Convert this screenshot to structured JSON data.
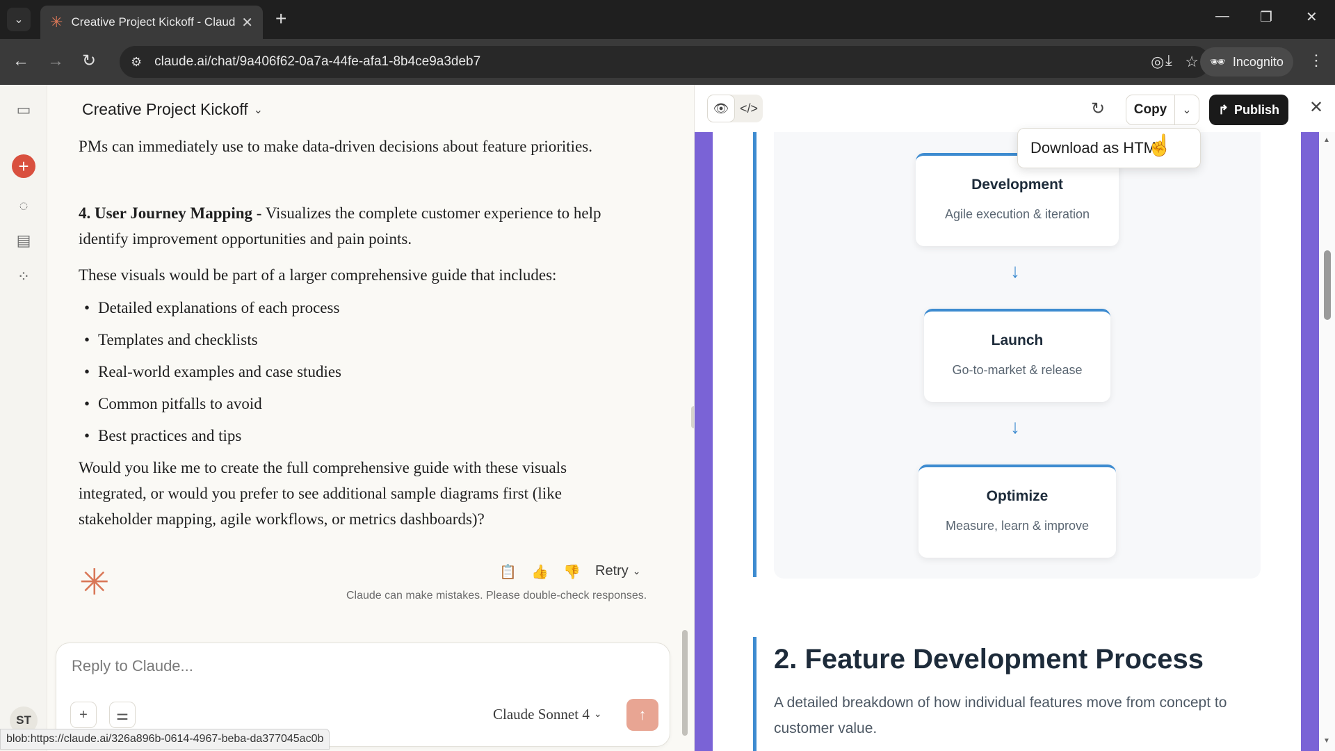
{
  "browser": {
    "tab_title": "Creative Project Kickoff - Claude",
    "url": "claude.ai/chat/9a406f62-0a7a-44fe-afa1-8b4ce9a3deb7",
    "incognito_label": "Incognito",
    "status_url": "blob:https://claude.ai/326a896b-0614-4967-beba-da377045ac0b"
  },
  "sidebar": {
    "avatar_initials": "ST"
  },
  "chat": {
    "title": "Creative Project Kickoff",
    "para_intro": "PMs can immediately use to make data-driven decisions about feature priorities.",
    "item4_title": "4. User Journey Mapping",
    "item4_text": " - Visualizes the complete customer experience to help identify improvement opportunities and pain points.",
    "guide_intro": "These visuals would be part of a larger comprehensive guide that includes:",
    "bullets": [
      "Detailed explanations of each process",
      "Templates and checklists",
      "Real-world examples and case studies",
      "Common pitfalls to avoid",
      "Best practices and tips"
    ],
    "closing": "Would you like me to create the full comprehensive guide with these visuals integrated, or would you prefer to see additional sample diagrams first (like stakeholder mapping, agile workflows, or metrics dashboards)?",
    "retry_label": "Retry",
    "disclaimer": "Claude can make mistakes. Please double-check responses.",
    "reply_placeholder": "Reply to Claude...",
    "model_label": "Claude Sonnet 4"
  },
  "artifact": {
    "copy_label": "Copy",
    "publish_label": "Publish",
    "menu_item": "Download as HTML",
    "stages": [
      {
        "title": "Development",
        "desc": "Agile execution & iteration"
      },
      {
        "title": "Launch",
        "desc": "Go-to-market & release"
      },
      {
        "title": "Optimize",
        "desc": "Measure, learn & improve"
      }
    ],
    "section_title": "2. Feature Development Process",
    "section_desc": "A detailed breakdown of how individual features move from concept to customer value."
  },
  "icons": {
    "favicon": "claude-asterisk-icon",
    "preview_toggle": "eye-icon",
    "code_toggle": "code-icon"
  },
  "colors": {
    "accent_claude": "#d97757",
    "diagram_blue": "#3d8bd0",
    "artifact_purple": "#7a63d6"
  }
}
